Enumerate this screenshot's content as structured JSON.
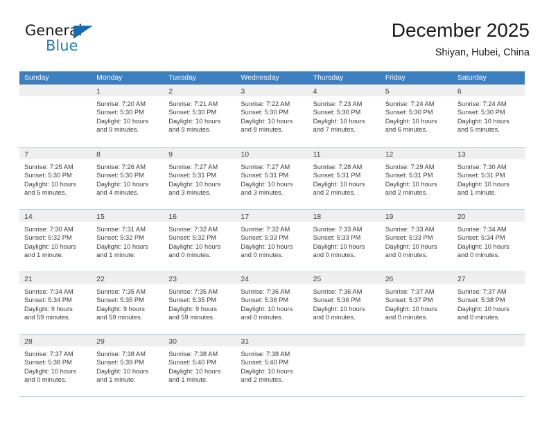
{
  "brand": {
    "name_part1": "General",
    "name_part2": "Blue",
    "triangle_icon": "triangle-icon",
    "accent_color": "#1b7ec4",
    "header_color": "#3c7fc0"
  },
  "header": {
    "title": "December 2025",
    "subtitle": "Shiyan, Hubei, China"
  },
  "calendar": {
    "weekday_headers": [
      "Sunday",
      "Monday",
      "Tuesday",
      "Wednesday",
      "Thursday",
      "Friday",
      "Saturday"
    ],
    "weeks": [
      [
        {
          "day": "",
          "lines": []
        },
        {
          "day": "1",
          "lines": [
            "Sunrise: 7:20 AM",
            "Sunset: 5:30 PM",
            "Daylight: 10 hours",
            "and 9 minutes."
          ]
        },
        {
          "day": "2",
          "lines": [
            "Sunrise: 7:21 AM",
            "Sunset: 5:30 PM",
            "Daylight: 10 hours",
            "and 9 minutes."
          ]
        },
        {
          "day": "3",
          "lines": [
            "Sunrise: 7:22 AM",
            "Sunset: 5:30 PM",
            "Daylight: 10 hours",
            "and 8 minutes."
          ]
        },
        {
          "day": "4",
          "lines": [
            "Sunrise: 7:23 AM",
            "Sunset: 5:30 PM",
            "Daylight: 10 hours",
            "and 7 minutes."
          ]
        },
        {
          "day": "5",
          "lines": [
            "Sunrise: 7:24 AM",
            "Sunset: 5:30 PM",
            "Daylight: 10 hours",
            "and 6 minutes."
          ]
        },
        {
          "day": "6",
          "lines": [
            "Sunrise: 7:24 AM",
            "Sunset: 5:30 PM",
            "Daylight: 10 hours",
            "and 5 minutes."
          ]
        }
      ],
      [
        {
          "day": "7",
          "lines": [
            "Sunrise: 7:25 AM",
            "Sunset: 5:30 PM",
            "Daylight: 10 hours",
            "and 5 minutes."
          ]
        },
        {
          "day": "8",
          "lines": [
            "Sunrise: 7:26 AM",
            "Sunset: 5:30 PM",
            "Daylight: 10 hours",
            "and 4 minutes."
          ]
        },
        {
          "day": "9",
          "lines": [
            "Sunrise: 7:27 AM",
            "Sunset: 5:31 PM",
            "Daylight: 10 hours",
            "and 3 minutes."
          ]
        },
        {
          "day": "10",
          "lines": [
            "Sunrise: 7:27 AM",
            "Sunset: 5:31 PM",
            "Daylight: 10 hours",
            "and 3 minutes."
          ]
        },
        {
          "day": "11",
          "lines": [
            "Sunrise: 7:28 AM",
            "Sunset: 5:31 PM",
            "Daylight: 10 hours",
            "and 2 minutes."
          ]
        },
        {
          "day": "12",
          "lines": [
            "Sunrise: 7:29 AM",
            "Sunset: 5:31 PM",
            "Daylight: 10 hours",
            "and 2 minutes."
          ]
        },
        {
          "day": "13",
          "lines": [
            "Sunrise: 7:30 AM",
            "Sunset: 5:31 PM",
            "Daylight: 10 hours",
            "and 1 minute."
          ]
        }
      ],
      [
        {
          "day": "14",
          "lines": [
            "Sunrise: 7:30 AM",
            "Sunset: 5:32 PM",
            "Daylight: 10 hours",
            "and 1 minute."
          ]
        },
        {
          "day": "15",
          "lines": [
            "Sunrise: 7:31 AM",
            "Sunset: 5:32 PM",
            "Daylight: 10 hours",
            "and 1 minute."
          ]
        },
        {
          "day": "16",
          "lines": [
            "Sunrise: 7:32 AM",
            "Sunset: 5:32 PM",
            "Daylight: 10 hours",
            "and 0 minutes."
          ]
        },
        {
          "day": "17",
          "lines": [
            "Sunrise: 7:32 AM",
            "Sunset: 5:33 PM",
            "Daylight: 10 hours",
            "and 0 minutes."
          ]
        },
        {
          "day": "18",
          "lines": [
            "Sunrise: 7:33 AM",
            "Sunset: 5:33 PM",
            "Daylight: 10 hours",
            "and 0 minutes."
          ]
        },
        {
          "day": "19",
          "lines": [
            "Sunrise: 7:33 AM",
            "Sunset: 5:33 PM",
            "Daylight: 10 hours",
            "and 0 minutes."
          ]
        },
        {
          "day": "20",
          "lines": [
            "Sunrise: 7:34 AM",
            "Sunset: 5:34 PM",
            "Daylight: 10 hours",
            "and 0 minutes."
          ]
        }
      ],
      [
        {
          "day": "21",
          "lines": [
            "Sunrise: 7:34 AM",
            "Sunset: 5:34 PM",
            "Daylight: 9 hours",
            "and 59 minutes."
          ]
        },
        {
          "day": "22",
          "lines": [
            "Sunrise: 7:35 AM",
            "Sunset: 5:35 PM",
            "Daylight: 9 hours",
            "and 59 minutes."
          ]
        },
        {
          "day": "23",
          "lines": [
            "Sunrise: 7:35 AM",
            "Sunset: 5:35 PM",
            "Daylight: 9 hours",
            "and 59 minutes."
          ]
        },
        {
          "day": "24",
          "lines": [
            "Sunrise: 7:36 AM",
            "Sunset: 5:36 PM",
            "Daylight: 10 hours",
            "and 0 minutes."
          ]
        },
        {
          "day": "25",
          "lines": [
            "Sunrise: 7:36 AM",
            "Sunset: 5:36 PM",
            "Daylight: 10 hours",
            "and 0 minutes."
          ]
        },
        {
          "day": "26",
          "lines": [
            "Sunrise: 7:37 AM",
            "Sunset: 5:37 PM",
            "Daylight: 10 hours",
            "and 0 minutes."
          ]
        },
        {
          "day": "27",
          "lines": [
            "Sunrise: 7:37 AM",
            "Sunset: 5:38 PM",
            "Daylight: 10 hours",
            "and 0 minutes."
          ]
        }
      ],
      [
        {
          "day": "28",
          "lines": [
            "Sunrise: 7:37 AM",
            "Sunset: 5:38 PM",
            "Daylight: 10 hours",
            "and 0 minutes."
          ]
        },
        {
          "day": "29",
          "lines": [
            "Sunrise: 7:38 AM",
            "Sunset: 5:39 PM",
            "Daylight: 10 hours",
            "and 1 minute."
          ]
        },
        {
          "day": "30",
          "lines": [
            "Sunrise: 7:38 AM",
            "Sunset: 5:40 PM",
            "Daylight: 10 hours",
            "and 1 minute."
          ]
        },
        {
          "day": "31",
          "lines": [
            "Sunrise: 7:38 AM",
            "Sunset: 5:40 PM",
            "Daylight: 10 hours",
            "and 2 minutes."
          ]
        },
        {
          "day": "",
          "lines": []
        },
        {
          "day": "",
          "lines": []
        },
        {
          "day": "",
          "lines": []
        }
      ]
    ]
  }
}
